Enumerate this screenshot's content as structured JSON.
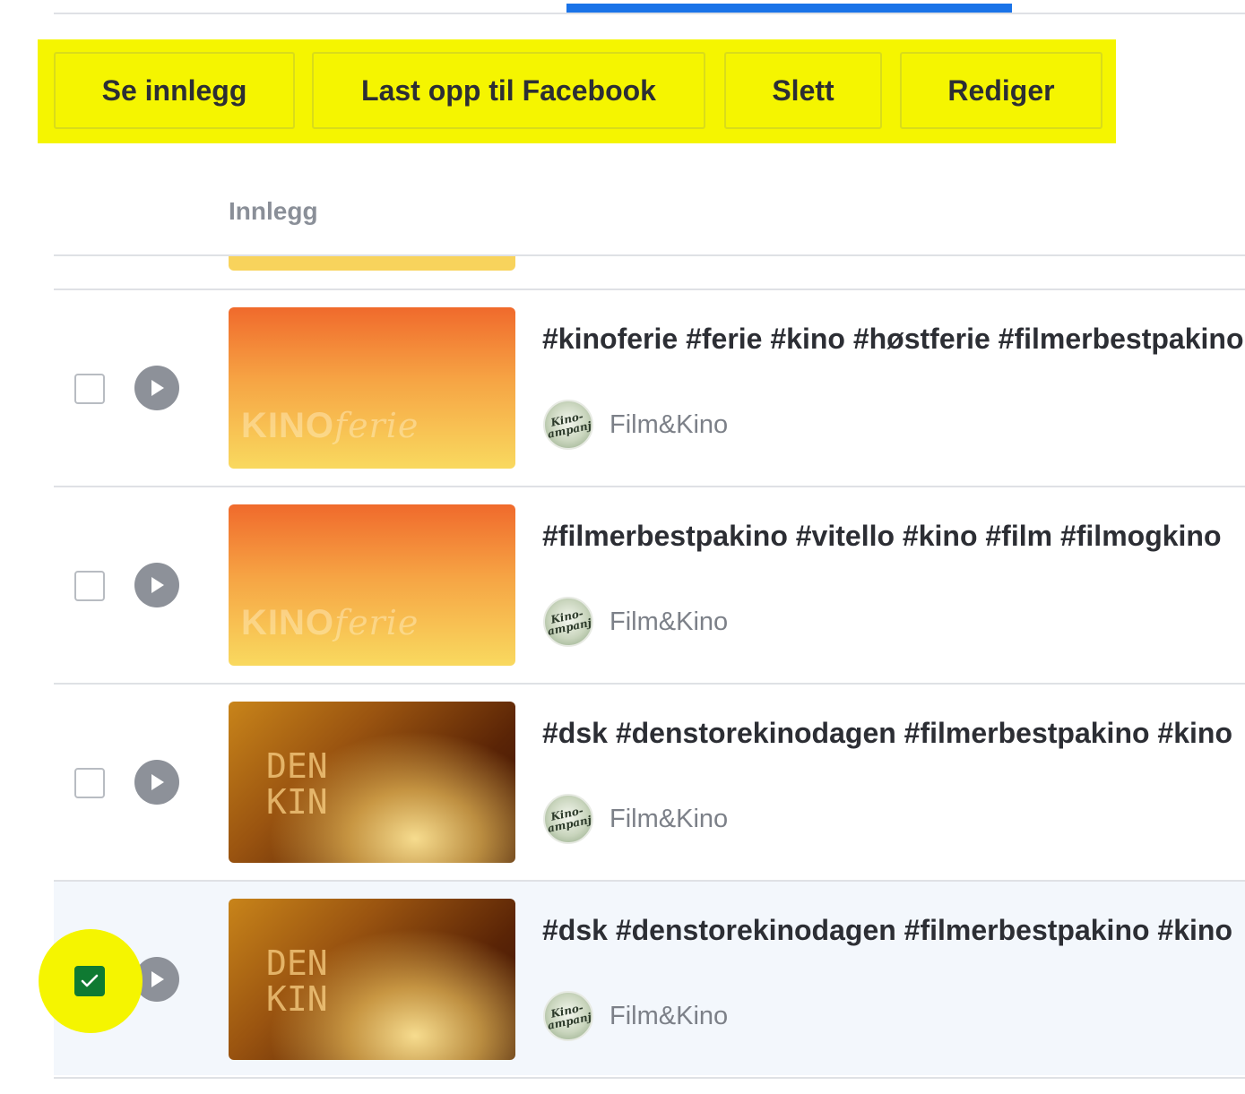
{
  "actions": {
    "view_post": "Se innlegg",
    "upload_facebook": "Last opp til Facebook",
    "delete": "Slett",
    "edit": "Rediger"
  },
  "table": {
    "column_header": "Innlegg",
    "rows": [
      {
        "selected": false,
        "thumbnail": "kinoferie",
        "title": "#kinoferie #ferie #kino #høstferie #filmerbestpakino",
        "page_name": "Film&Kino"
      },
      {
        "selected": false,
        "thumbnail": "kinoferie",
        "title": "#filmerbestpakino #vitello #kino #film #filmogkino",
        "page_name": "Film&Kino"
      },
      {
        "selected": false,
        "thumbnail": "den-store-kinodagen",
        "title": "#dsk #denstorekinodagen #filmerbestpakino #kino",
        "page_name": "Film&Kino"
      },
      {
        "selected": true,
        "thumbnail": "den-store-kinodagen",
        "title": "#dsk #denstorekinodagen #filmerbestpakino #kino",
        "page_name": "Film&Kino"
      }
    ]
  },
  "thumb_text": {
    "kino": "KINO",
    "ferie": "ferie",
    "den": "DEN\nKIN"
  },
  "avatar_text": "Kino-\nkampanje",
  "colors": {
    "highlight": "#f5f500",
    "tab_indicator": "#1a73e8",
    "checkbox_checked": "#0f7a32",
    "selected_row": "#f3f7fc"
  }
}
